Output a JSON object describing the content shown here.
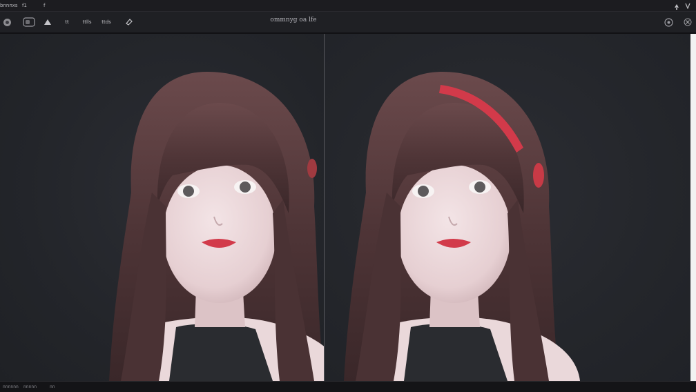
{
  "menubar": {
    "app_label": "bnnnxs",
    "item_1": "f1",
    "item_2": "f",
    "right_icon_1": "bell-icon",
    "right_icon_2": "chevron-icon"
  },
  "toolbar": {
    "title": "ommnyg oa lfe",
    "tool_label_1": "tt",
    "tool_label_2": "ttlls",
    "tool_label_3": "ttds",
    "icons": [
      "logo-icon",
      "toggle-icon",
      "triangle-icon",
      "pen-icon",
      "eraser-icon",
      "settings-icon",
      "close-icon"
    ]
  },
  "canvas": {
    "left_image": "portrait-original",
    "right_image": "portrait-with-red-headband",
    "accent_color": "#d23a4a"
  },
  "statusbar": {
    "item_1": "nnnnnn",
    "item_2": "nnnnn",
    "item_3": "nn"
  }
}
